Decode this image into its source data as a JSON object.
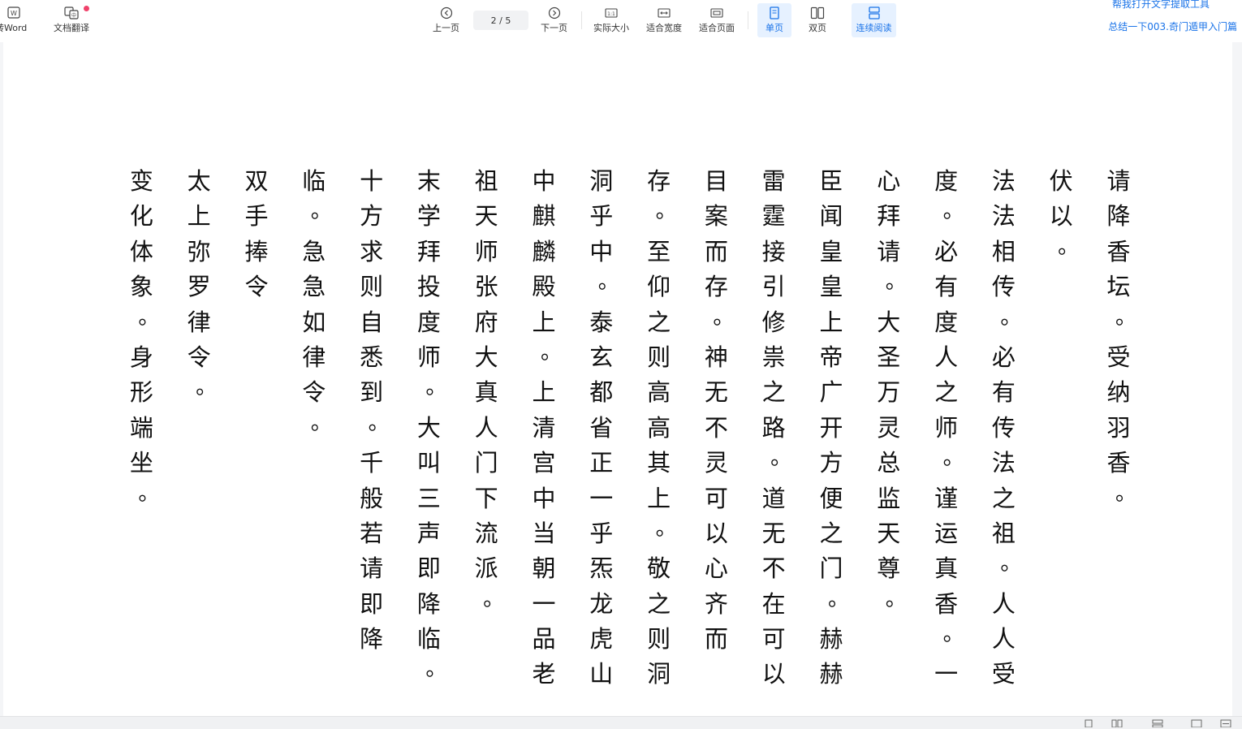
{
  "toolbar": {
    "to_word": "转Word",
    "translate": "文档翻译",
    "prev_page": "上一页",
    "page_indicator": "2 / 5",
    "next_page": "下一页",
    "actual_size": "实际大小",
    "fit_width": "适合宽度",
    "fit_page": "适合页面",
    "single_page": "单页",
    "double_page": "双页",
    "continuous": "连续阅读",
    "ocr_link": "帮我打开文字提取工具",
    "doc_title": "总结一下003.奇门遁甲入门篇"
  },
  "icons": {
    "word": "word-icon",
    "translate": "translate-icon",
    "prev": "circle-left-icon",
    "next": "circle-right-icon",
    "actual": "actual-size-icon",
    "fitw": "fit-width-icon",
    "fitp": "fit-page-icon",
    "single": "single-page-icon",
    "double": "double-page-icon",
    "cont": "continuous-icon"
  },
  "colors": {
    "accent": "#1a73e8",
    "active_bg": "#e6f1ff",
    "notification": "#f0426b"
  },
  "document": {
    "columns": [
      "请降香坛。受纳羽香。",
      "伏以。",
      "法法相传。必有传法之祖。人人受",
      "度。必有度人之师。谨运真香。一",
      "心拜请。大圣万灵总监天尊。",
      "臣闻皇皇上帝广开方便之门。赫赫",
      "雷霆接引修祟之路。道无不在可以",
      "目案而存。神无不灵可以心齐而",
      "存。至仰之则高高其上。敬之则洞",
      "洞乎中。泰玄都省正一乎炁龙虎山",
      "中麒麟殿上。上清宫中当朝一品老",
      "祖天师张府大真人门下流派。",
      "末学拜投度师。大叫三声即降临。",
      "十方求则自悉到。千般若请即降",
      "临。急急如律令。",
      "双手捧令",
      "太上弥罗律令。",
      "变化体象。身形端坐。"
    ]
  }
}
